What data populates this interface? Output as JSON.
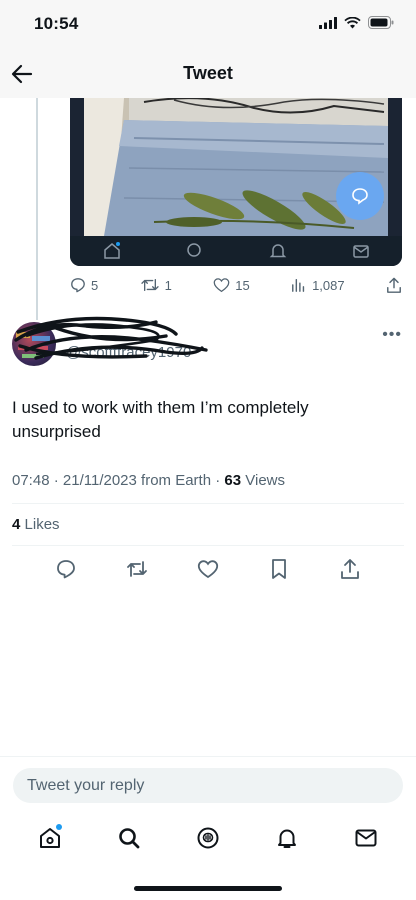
{
  "status_bar": {
    "time": "10:54"
  },
  "header": {
    "title": "Tweet"
  },
  "parent_tweet": {
    "replies": "5",
    "retweets": "1",
    "likes": "15",
    "views": "1,087"
  },
  "reply_tweet": {
    "handle": "@scottttracey1970",
    "text": "I used to work with them I’m completely unsurprised",
    "time": "07:48",
    "date": "21/11/2023",
    "source": "from Earth",
    "views_count": "63",
    "views_label": "Views",
    "likes_count": "4",
    "likes_label": "Likes"
  },
  "reply_box": {
    "placeholder": "Tweet your reply"
  },
  "colors": {
    "accent": "#1d9bf0",
    "secondary_text": "#536471",
    "primary_text": "#0f1419"
  },
  "icons": {
    "back": "arrow-left-icon",
    "reply": "reply-icon",
    "retweet": "retweet-icon",
    "like": "heart-icon",
    "bookmark": "bookmark-icon",
    "share": "share-icon",
    "views": "bar-chart-icon",
    "home": "home-icon",
    "search": "search-icon",
    "spaces": "spaces-icon",
    "notifications": "bell-icon",
    "messages": "mail-icon"
  }
}
